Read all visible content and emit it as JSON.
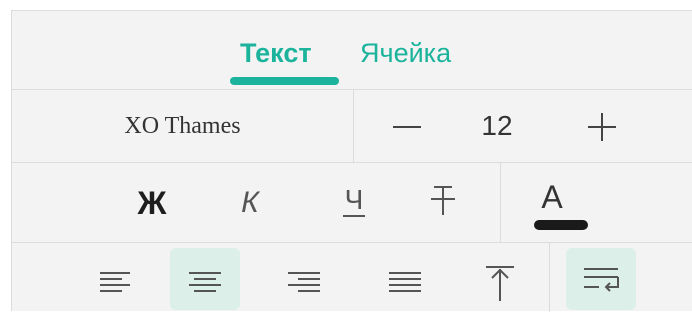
{
  "tabs": [
    {
      "label": "Текст",
      "active": true
    },
    {
      "label": "Ячейка",
      "active": false
    }
  ],
  "font": {
    "name": "XO Thames",
    "size": "12"
  },
  "style_buttons": {
    "bold": "Ж",
    "italic": "К",
    "underline": "Ч",
    "font_color_letter": "A",
    "font_color": "#1a1a1a"
  },
  "alignment": {
    "selected": "center",
    "wrap_text_enabled": true
  },
  "colors": {
    "accent": "#1bb39b",
    "selected_background": "#dcefe9"
  }
}
